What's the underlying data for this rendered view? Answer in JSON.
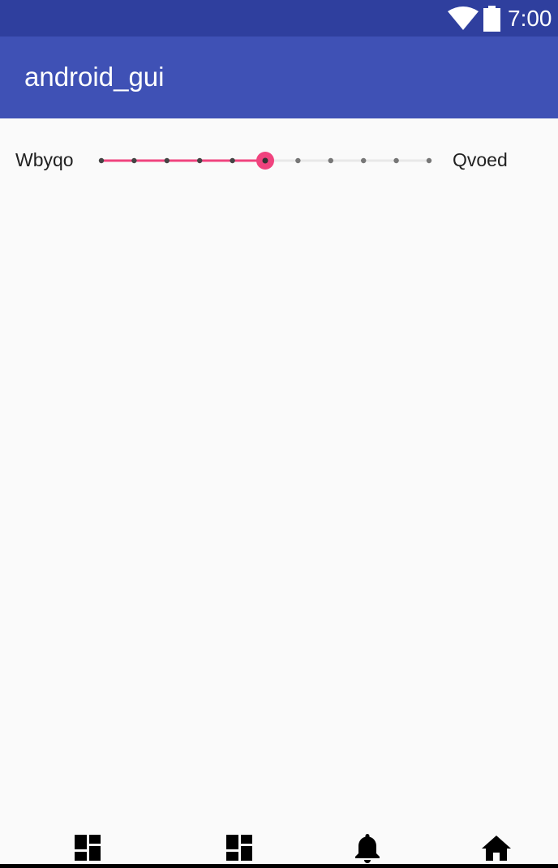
{
  "status_bar": {
    "time": "7:00",
    "icons": [
      "wifi-icon",
      "battery-icon"
    ],
    "background": "#2f3f9e"
  },
  "app_bar": {
    "title": "android_gui",
    "background": "#3f51b5"
  },
  "seekbar": {
    "left_label": "Wbyqo",
    "right_label": "Qvoed",
    "max": 10,
    "progress": 5,
    "accent_color": "#f0437e"
  },
  "bottom_nav": {
    "items": [
      {
        "icon": "dashboard-icon"
      },
      {
        "icon": "dashboard-icon"
      },
      {
        "icon": "bell-icon"
      },
      {
        "icon": "home-icon"
      }
    ]
  }
}
